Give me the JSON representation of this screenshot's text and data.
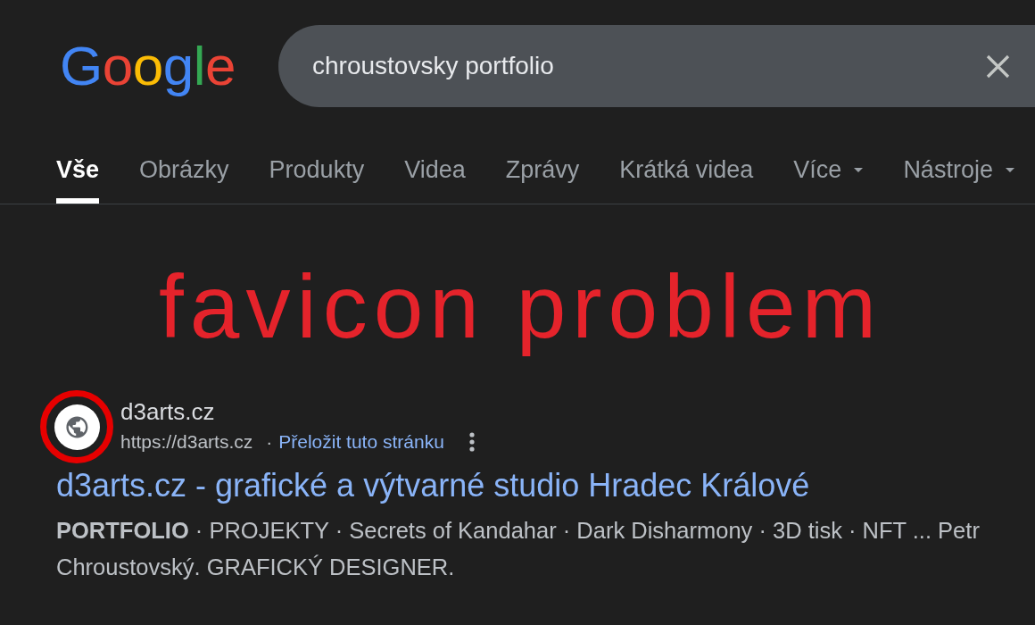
{
  "logo": {
    "text": "Google"
  },
  "search": {
    "value": "chroustovsky portfolio"
  },
  "tabs": [
    {
      "label": "Vše",
      "selected": true,
      "kind": "link"
    },
    {
      "label": "Obrázky",
      "selected": false,
      "kind": "link"
    },
    {
      "label": "Produkty",
      "selected": false,
      "kind": "link"
    },
    {
      "label": "Videa",
      "selected": false,
      "kind": "link"
    },
    {
      "label": "Zprávy",
      "selected": false,
      "kind": "link"
    },
    {
      "label": "Krátká videa",
      "selected": false,
      "kind": "link"
    },
    {
      "label": "Více",
      "selected": false,
      "kind": "menu"
    },
    {
      "label": "Nástroje",
      "selected": false,
      "kind": "menu"
    }
  ],
  "annotation": {
    "text": "favicon problem"
  },
  "result": {
    "favicon_highlighted": true,
    "site_name": "d3arts.cz",
    "url": "https://d3arts.cz",
    "separator": "·",
    "translate_link": "Přeložit tuto stránku",
    "title": "d3arts.cz - grafické a výtvarné studio Hradec Králové",
    "snippet": "**PORTFOLIO** · PROJEKTY · Secrets of Kandahar · Dark Disharmony · 3D tisk · NFT ... Petr Chroustovský. GRAFICKÝ DESIGNER."
  }
}
